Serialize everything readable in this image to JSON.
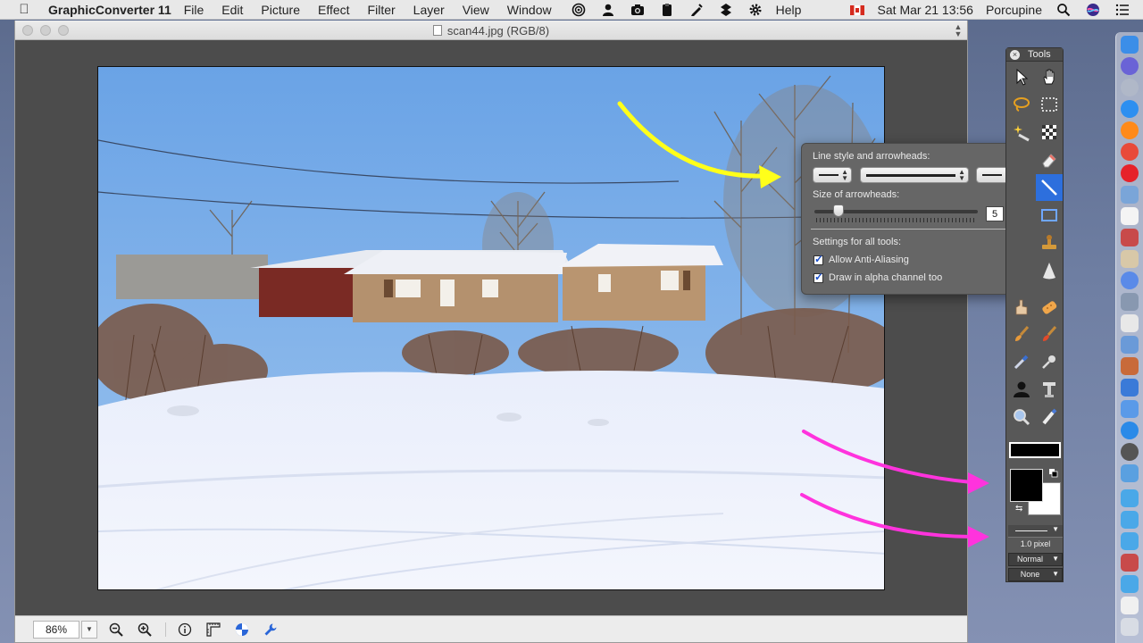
{
  "menubar": {
    "app_name": "GraphicConverter 11",
    "menus": [
      "File",
      "Edit",
      "Picture",
      "Effect",
      "Filter",
      "Layer",
      "View",
      "Window",
      "Help"
    ],
    "clock": "Sat Mar 21  13:56",
    "user": "Porcupine",
    "status_icons": [
      "target-icon",
      "person-icon",
      "camera-icon",
      "clipboard-icon",
      "pen-icon",
      "dropbox-icon",
      "gear-icon"
    ]
  },
  "window": {
    "title": "scan44.jpg (RGB/8)"
  },
  "statusbar": {
    "zoom": "86%"
  },
  "popover": {
    "line_style_label": "Line style and arrowheads:",
    "arrow_size_label": "Size of arrowheads:",
    "arrow_size_value": "5",
    "slider_fraction": 0.15,
    "settings_label": "Settings for all tools:",
    "anti_aliasing_label": "Allow Anti-Aliasing",
    "anti_aliasing_checked": true,
    "alpha_label": "Draw in alpha channel too",
    "alpha_checked": true
  },
  "tools": {
    "title": "Tools",
    "selected_tool": "line-tool",
    "stroke_width": "1.0 pixel",
    "blend_mode": "Normal",
    "arrow_mode": "None",
    "foreground_color": "#000000",
    "background_color": "#ffffff"
  },
  "annotation_colors": {
    "yellow_arrow": "#ffff1a",
    "magenta_arrows": "#ff33dd"
  }
}
